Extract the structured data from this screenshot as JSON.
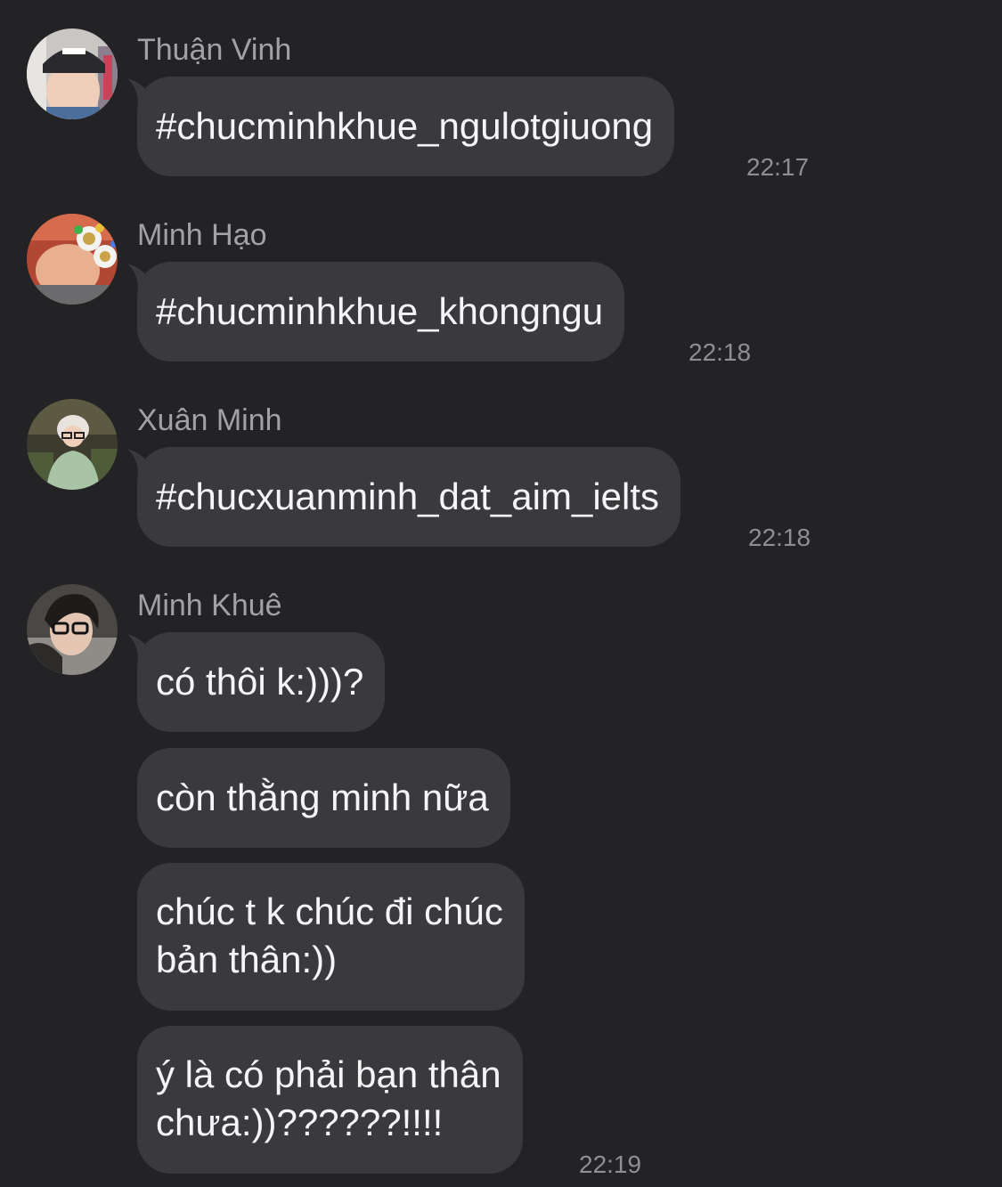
{
  "messages": [
    {
      "sender": "Thuận Vinh",
      "avatar_icon": "user-avatar-thuan-vinh-icon",
      "text": "#chucminhkhue_ngulotgiuong",
      "time": "22:17"
    },
    {
      "sender": "Minh Hạo",
      "avatar_icon": "user-avatar-minh-hao-icon",
      "text": "#chucminhkhue_khongngu",
      "time": "22:18"
    },
    {
      "sender": "Xuân Minh",
      "avatar_icon": "user-avatar-xuan-minh-icon",
      "text": "#chucxuanminh_dat_aim_ielts",
      "time": "22:18"
    },
    {
      "sender": "Minh Khuê",
      "avatar_icon": "user-avatar-minh-khue-icon",
      "bubbles": [
        {
          "lines": [
            "có thôi k:)))?"
          ]
        },
        {
          "lines": [
            "còn thằng minh nữa"
          ]
        },
        {
          "lines": [
            "chúc t k chúc đi chúc",
            "bản thân:))"
          ]
        },
        {
          "lines": [
            "ý là có phải bạn thân",
            "chưa:))??????!!!!"
          ]
        }
      ],
      "time": "22:19"
    }
  ],
  "colors": {
    "background": "#232325",
    "bubble": "#3a3a3c",
    "sender_name": "#a1a1a6",
    "timestamp": "#8e8e93",
    "message_text": "#f5f5f7"
  }
}
